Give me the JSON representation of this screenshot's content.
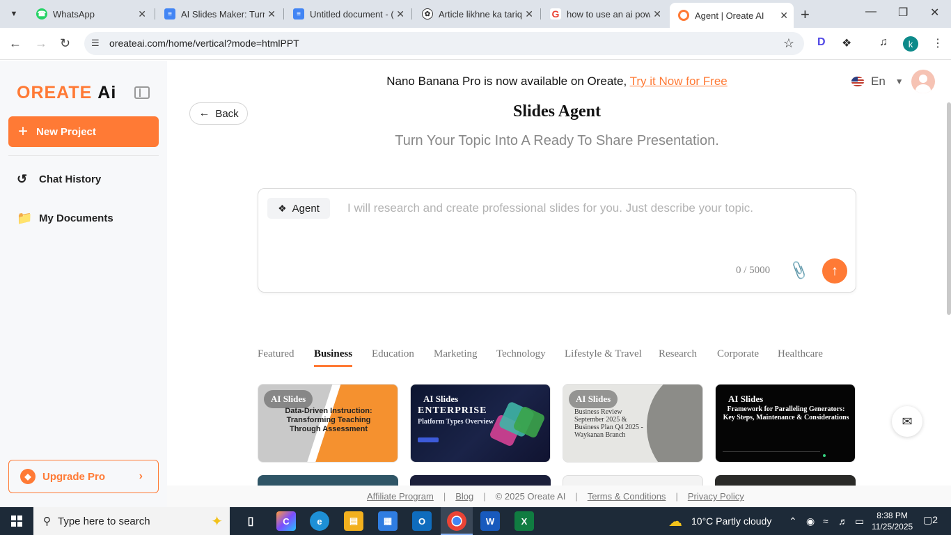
{
  "browser": {
    "tabs": [
      {
        "label": "WhatsApp",
        "favicon": "whatsapp-icon",
        "color": "#25d366"
      },
      {
        "label": "AI Slides Maker: Turn",
        "favicon": "docs-icon",
        "color": "#4285f4"
      },
      {
        "label": "Untitled document - (",
        "favicon": "docs-icon",
        "color": "#4285f4"
      },
      {
        "label": "Article likhne ka tariq",
        "favicon": "openai-icon",
        "color": "#333333"
      },
      {
        "label": "how to use an ai pow",
        "favicon": "google-icon",
        "color": "#ea4335"
      },
      {
        "label": "Agent | Oreate AI",
        "favicon": "oreate-icon",
        "color": "#ff7a35"
      }
    ],
    "url": "oreateai.com/home/vertical?mode=htmlPPT",
    "profile_initial": "k"
  },
  "sidebar": {
    "logo_o": "O",
    "logo_reate": "REATE",
    "logo_ai": "Ai",
    "new_project": "New Project",
    "items": [
      {
        "label": "Chat History",
        "icon": "history-icon"
      },
      {
        "label": "My Documents",
        "icon": "folder-icon"
      }
    ],
    "upgrade": "Upgrade Pro"
  },
  "banner": {
    "text": "Nano Banana Pro is now available on Oreate,",
    "link": "Try it Now for Free"
  },
  "lang": "En",
  "back": "Back",
  "title": "Slides Agent",
  "subtitle": "Turn Your Topic Into A Ready To Share Presentation.",
  "composer": {
    "agent_label": "Agent",
    "placeholder": "I will research and create professional slides for you. Just describe your topic.",
    "counter": "0 / 5000"
  },
  "categories": [
    "Featured",
    "Business",
    "Education",
    "Marketing",
    "Technology",
    "Lifestyle & Travel",
    "Research",
    "Corporate",
    "Healthcare"
  ],
  "active_category": "Business",
  "cards": [
    {
      "badge": "AI Slides",
      "title": "Data-Driven Instruction: Transforming Teaching Through Assessment"
    },
    {
      "badge": "AI Slides",
      "title": "ENTERPRISE",
      "subtitle": "Platform Types Overview"
    },
    {
      "badge": "AI Slides",
      "title": "Business Review September 2025 & Business Plan Q4 2025 - Waykanan Branch"
    },
    {
      "badge": "AI Slides",
      "title": "Framework for Paralleling Generators: Key Steps, Maintenance & Considerations"
    }
  ],
  "footer": {
    "affiliate": "Affiliate Program",
    "blog": "Blog",
    "copyright": "2025 Oreate AI",
    "terms": "Terms & Conditions",
    "privacy": "Privacy Policy"
  },
  "taskbar": {
    "search_placeholder": "Type here to search",
    "weather": "10°C  Partly cloudy",
    "time": "8:38 PM",
    "date": "11/25/2025",
    "notifications": "2"
  },
  "colors": {
    "accent": "#ff7a35",
    "taskbar": "#1d2a38"
  }
}
